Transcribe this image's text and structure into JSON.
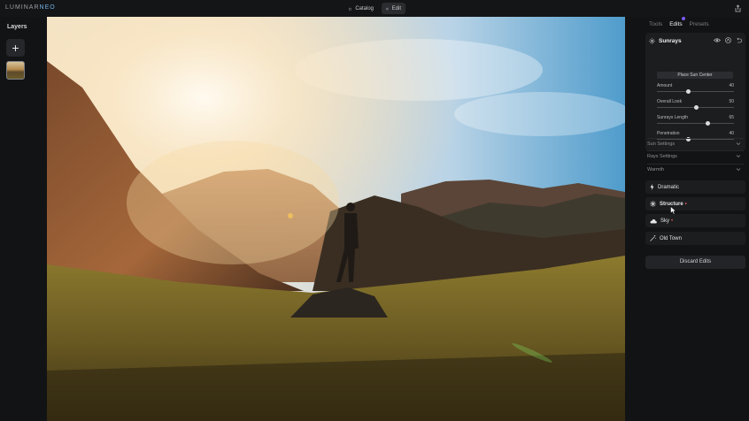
{
  "topbar": {
    "logo_main": "LUMINAR",
    "logo_accent": "NEO",
    "catalog_label": "Catalog",
    "edit_label": "Edit"
  },
  "layers": {
    "title": "Layers"
  },
  "panel": {
    "tabs": [
      "Tools",
      "Edits",
      "Presets"
    ],
    "active_tab": "Edits",
    "sunrays": {
      "title": "Sunrays",
      "place_sun_label": "Place Sun Center",
      "sliders": [
        {
          "label": "Amount",
          "value": "40",
          "level": 40
        },
        {
          "label": "Overall Look",
          "value": "50",
          "level": 50
        },
        {
          "label": "Sunrays Length",
          "value": "65",
          "level": 65
        },
        {
          "label": "Penetration",
          "value": "40",
          "level": 40
        }
      ],
      "sections": [
        "Sun Settings",
        "Rays Settings",
        "Warmth"
      ]
    },
    "tools": [
      {
        "label": "Dramatic",
        "icon": "bolt-icon",
        "modified": false
      },
      {
        "label": "Structure",
        "icon": "structure-icon",
        "modified": true
      },
      {
        "label": "Sky",
        "icon": "cloud-icon",
        "modified": true
      },
      {
        "label": "Old Town",
        "icon": "magic-wand-icon",
        "modified": false
      }
    ],
    "discard_label": "Discard Edits"
  },
  "colors": {
    "accent": "#7a5cff",
    "modified_marker": "#e06060",
    "panel_bg": "#1c1d1f",
    "app_bg": "#121314"
  }
}
